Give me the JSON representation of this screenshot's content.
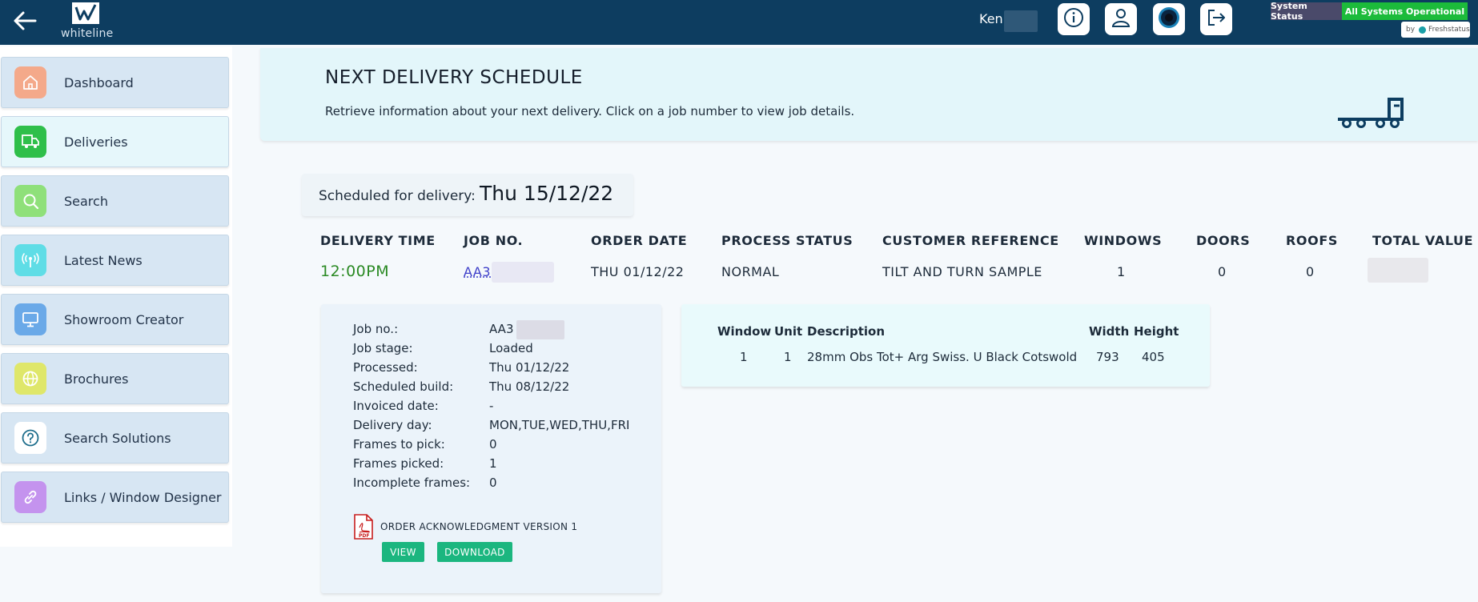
{
  "header": {
    "logo_text": "whiteline",
    "user_name": "Ken",
    "status_label": "System Status",
    "status_value": "All Systems Operational",
    "status_by": "by",
    "status_provider": "Freshstatus",
    "status_color": "#1cbb3b"
  },
  "sidebar": {
    "items": [
      {
        "label": "Dashboard",
        "icon": "home-icon",
        "color": "#f4a98a"
      },
      {
        "label": "Deliveries",
        "icon": "truck-icon",
        "color": "#2fbf4a"
      },
      {
        "label": "Search",
        "icon": "search-icon",
        "color": "#8fe07a"
      },
      {
        "label": "Latest News",
        "icon": "broadcast-icon",
        "color": "#5fdde6"
      },
      {
        "label": "Showroom Creator",
        "icon": "monitor-icon",
        "color": "#6aa9e8"
      },
      {
        "label": "Brochures",
        "icon": "globe-icon",
        "color": "#dfe76a"
      },
      {
        "label": "Search Solutions",
        "icon": "question-icon",
        "color": "#ffffff"
      },
      {
        "label": "Links / Window Designer",
        "icon": "link-icon",
        "color": "#c493ee"
      }
    ]
  },
  "banner": {
    "title": "NEXT DELIVERY SCHEDULE",
    "subtitle": "Retrieve information about your next delivery. Click on a job number to view job details."
  },
  "schedule": {
    "label": "Scheduled for delivery:",
    "date": "Thu 15/12/22"
  },
  "delivery_table": {
    "headers": [
      "DELIVERY TIME",
      "JOB NO.",
      "ORDER DATE",
      "PROCESS STATUS",
      "CUSTOMER REFERENCE",
      "WINDOWS",
      "DOORS",
      "ROOFS",
      "TOTAL VALUE"
    ],
    "row": {
      "time": "12:00PM",
      "job_no": "AA3",
      "order_date": "THU 01/12/22",
      "status": "NORMAL",
      "customer_ref": "TILT AND TURN SAMPLE",
      "windows": "1",
      "doors": "0",
      "roofs": "0"
    }
  },
  "job_details": {
    "fields": [
      {
        "label": "Job no.:",
        "value": "AA3"
      },
      {
        "label": "Job stage:",
        "value": "Loaded"
      },
      {
        "label": "Processed:",
        "value": "Thu 01/12/22"
      },
      {
        "label": "Scheduled build:",
        "value": "Thu 08/12/22"
      },
      {
        "label": "Invoiced date:",
        "value": "-"
      },
      {
        "label": "Delivery day:",
        "value": "MON,TUE,WED,THU,FRI"
      },
      {
        "label": "Frames to pick:",
        "value": "0"
      },
      {
        "label": "Frames picked:",
        "value": "1"
      },
      {
        "label": "Incomplete frames:",
        "value": "0"
      }
    ],
    "document_title": "ORDER ACKNOWLEDGMENT VERSION 1",
    "pdf_badge": "PDF",
    "view_label": "VIEW",
    "download_label": "DOWNLOAD"
  },
  "items_table": {
    "headers": [
      "Window",
      "Unit",
      "Description",
      "Width",
      "Height"
    ],
    "rows": [
      [
        "1",
        "1",
        "28mm Obs Tot+ Arg Swiss. U Black Cotswold",
        "793",
        "405"
      ]
    ]
  }
}
